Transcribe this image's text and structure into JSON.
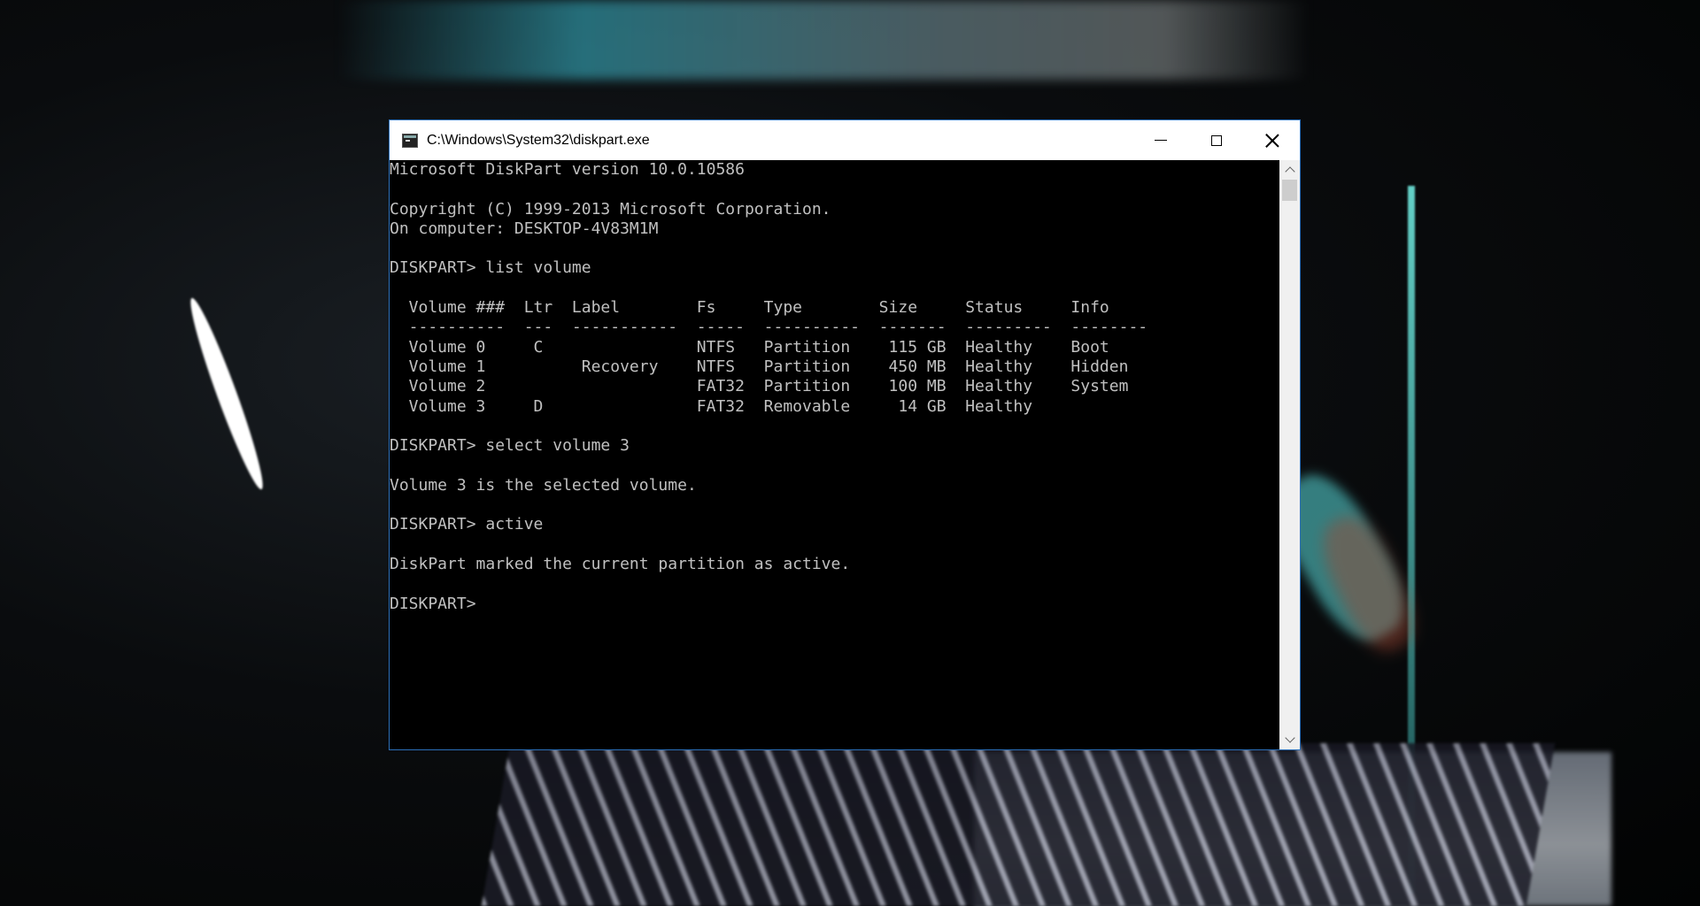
{
  "window": {
    "title": "C:\\Windows\\System32\\diskpart.exe",
    "icon": "console-app-icon"
  },
  "controls": {
    "minimize": "minimize",
    "maximize": "maximize",
    "close": "close"
  },
  "console": {
    "lines": [
      "Microsoft DiskPart version 10.0.10586",
      "",
      "Copyright (C) 1999-2013 Microsoft Corporation.",
      "On computer: DESKTOP-4V83M1M",
      "",
      "DISKPART> list volume",
      "",
      "  Volume ###  Ltr  Label        Fs     Type        Size     Status     Info",
      "  ----------  ---  -----------  -----  ----------  -------  ---------  --------",
      "  Volume 0     C                NTFS   Partition    115 GB  Healthy    Boot",
      "  Volume 1          Recovery    NTFS   Partition    450 MB  Healthy    Hidden",
      "  Volume 2                      FAT32  Partition    100 MB  Healthy    System",
      "  Volume 3     D                FAT32  Removable     14 GB  Healthy",
      "",
      "DISKPART> select volume 3",
      "",
      "Volume 3 is the selected volume.",
      "",
      "DISKPART> active",
      "",
      "DiskPart marked the current partition as active.",
      "",
      "DISKPART> "
    ]
  }
}
